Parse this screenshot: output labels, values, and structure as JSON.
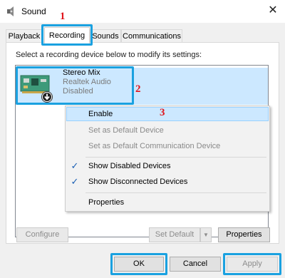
{
  "window": {
    "title": "Sound",
    "close_glyph": "✕",
    "app_icon": "speaker-icon"
  },
  "tabs": [
    {
      "label": "Playback",
      "selected": false
    },
    {
      "label": "Recording",
      "selected": true
    },
    {
      "label": "Sounds",
      "selected": false
    },
    {
      "label": "Communications",
      "selected": false
    }
  ],
  "instruction": "Select a recording device below to modify its settings:",
  "device": {
    "name": "Stereo Mix",
    "driver": "Realtek Audio",
    "status": "Disabled",
    "icon": "sound-card-icon",
    "badge_icon": "disabled-arrow-icon"
  },
  "context_menu": {
    "items": [
      {
        "label": "Enable",
        "enabled": true,
        "highlighted": true,
        "checked": false
      },
      {
        "label": "Set as Default Device",
        "enabled": false,
        "checked": false
      },
      {
        "label": "Set as Default Communication Device",
        "enabled": false,
        "checked": false
      },
      {
        "label": "Show Disabled Devices",
        "enabled": true,
        "checked": true
      },
      {
        "label": "Show Disconnected Devices",
        "enabled": true,
        "checked": true
      },
      {
        "label": "Properties",
        "enabled": true,
        "checked": false
      }
    ],
    "check_glyph": "✓"
  },
  "buttons": {
    "configure": "Configure",
    "set_default": "Set Default",
    "set_default_arrow": "▼",
    "properties": "Properties",
    "ok": "OK",
    "cancel": "Cancel",
    "apply": "Apply"
  },
  "annotations": {
    "n1": "1",
    "n2": "2",
    "n3": "3"
  },
  "colors": {
    "highlight": "#1aa1e0",
    "annotation_number": "#e0141b",
    "selection": "#cce8ff"
  }
}
